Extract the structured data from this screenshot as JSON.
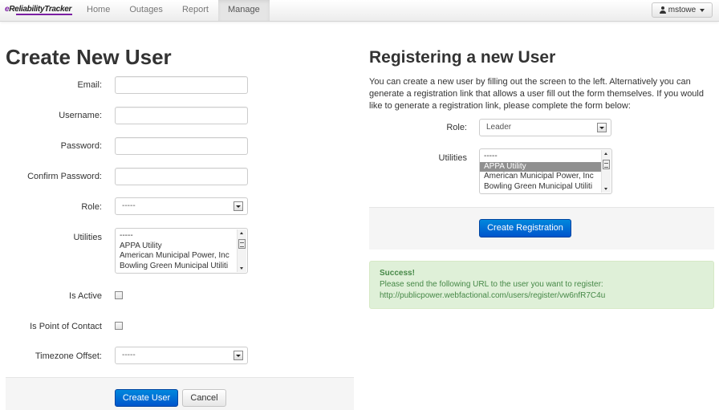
{
  "nav": {
    "brand_prefix": "e",
    "brand_name": "Reliability",
    "brand_suffix": "Tracker",
    "items": [
      "Home",
      "Outages",
      "Report",
      "Manage"
    ],
    "active": "Manage",
    "user": "mstowe"
  },
  "create_form": {
    "title": "Create New User",
    "labels": {
      "email": "Email:",
      "username": "Username:",
      "password": "Password:",
      "confirm_password": "Confirm Password:",
      "role": "Role:",
      "utilities": "Utilities",
      "is_active": "Is Active",
      "is_poc": "Is Point of Contact",
      "timezone": "Timezone Offset:"
    },
    "role_value": "-----",
    "timezone_value": "-----",
    "utilities_options": [
      "-----",
      "APPA Utility",
      "American Municipal Power, Inc",
      "Bowling Green Municipal Utiliti"
    ],
    "create_button": "Create User",
    "cancel_button": "Cancel"
  },
  "register": {
    "title": "Registering a new User",
    "description": "You can create a new user by filling out the screen to the left. Alternatively you can generate a registration link that allows a user fill out the form themselves. If you would like to generate a registration link, please complete the form below:",
    "role_label": "Role:",
    "role_value": "Leader",
    "utilities_label": "Utilities",
    "utilities_options": [
      "-----",
      "APPA Utility",
      "American Municipal Power, Inc",
      "Bowling Green Municipal Utiliti"
    ],
    "utilities_selected": "APPA Utility",
    "button": "Create Registration",
    "alert_title": "Success!",
    "alert_message": "Please send the following URL to the user you want to register:",
    "alert_url": "http://publicpower.webfactional.com/users/register/vw6nfR7C4u"
  }
}
